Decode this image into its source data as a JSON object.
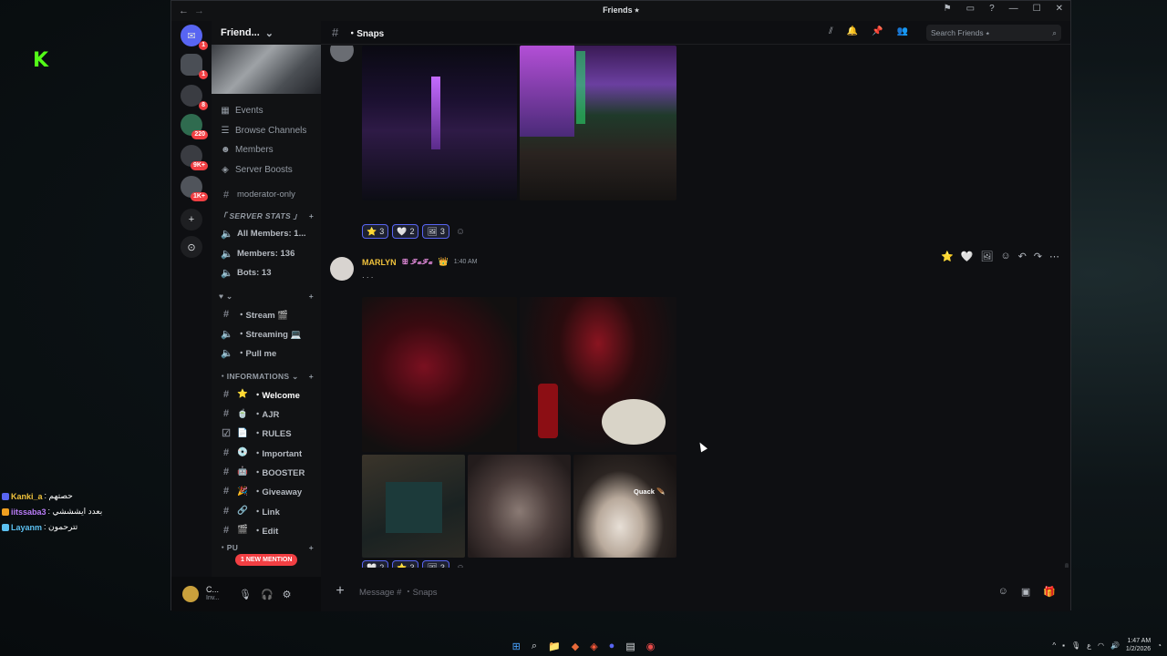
{
  "window": {
    "title": "Friends ⭑",
    "nav_back": "←",
    "nav_forward": "→"
  },
  "server": {
    "name": "Friend...",
    "rail_badges": [
      "1",
      "1",
      "8",
      "220",
      "9K+",
      "1K+"
    ]
  },
  "sidebar": {
    "nav_items": [
      {
        "label": "Events",
        "icon": "calendar-icon"
      },
      {
        "label": "Browse Channels",
        "icon": "browse-icon"
      },
      {
        "label": "Members",
        "icon": "members-icon"
      },
      {
        "label": "Server Boosts",
        "icon": "boost-icon"
      }
    ],
    "moderator_channel": "moderator-only",
    "stats_category": "「 SERVER STATS 」",
    "stats": [
      "All Members: 1...",
      "Members: 136",
      "Bots: 13"
    ],
    "voice_category": "♥ ⌄",
    "voice_channels": [
      "・Stream 🎬",
      "・Streaming 💻",
      "・Pull me"
    ],
    "info_category": "・INFORMATIONS ⌄",
    "info_channels": [
      {
        "label": "・Welcome",
        "emoji": "⭐",
        "active": true
      },
      {
        "label": "・AJR",
        "emoji": "🍵",
        "active": false
      },
      {
        "label": "・RULES",
        "emoji": "📄",
        "active": false
      },
      {
        "label": "・Important",
        "emoji": "💿",
        "active": false
      },
      {
        "label": "・BOOSTER",
        "emoji": "🤖",
        "active": false
      },
      {
        "label": "・Giveaway",
        "emoji": "🎉",
        "active": false
      },
      {
        "label": "・Link",
        "emoji": "🔗",
        "active": false
      },
      {
        "label": "・Edit",
        "emoji": "🎬",
        "active": false
      }
    ],
    "partial_category": "・PU",
    "mention_pill": "1 NEW MENTION"
  },
  "user_panel": {
    "name": "C...",
    "status": "Inv..."
  },
  "channel": {
    "name": "・Snaps",
    "search_placeholder": "Search Friends ⭑"
  },
  "messages": [
    {
      "author": "",
      "text": "",
      "reactions": [
        {
          "emoji": "⭐",
          "count": "3"
        },
        {
          "emoji": "🤍",
          "count": "2"
        },
        {
          "emoji": "🖼",
          "count": "3"
        }
      ]
    },
    {
      "author": "MARLYN",
      "badge": "👑",
      "role_tag": "ꕥ ℱ𝒶ℱ𝒶",
      "time": "1:40 AM",
      "text": "·  ·  ·",
      "image_caption": "Quack 🪶",
      "reactions": [
        {
          "emoji": "🤍",
          "count": "2"
        },
        {
          "emoji": "⭐",
          "count": "3"
        },
        {
          "emoji": "🖼",
          "count": "3"
        }
      ]
    }
  ],
  "composer": {
    "placeholder": "Message # ・Snaps"
  },
  "overlay_chat": [
    {
      "user": "Kanki_a",
      "message": ": حصتهم",
      "color": "#f0c23c"
    },
    {
      "user": "iitssaba3",
      "message": ": بعدد ايشششي",
      "color": "#b97cf7"
    },
    {
      "user": "Layanm",
      "message": ": تترحمون",
      "color": "#5bc0f0"
    }
  ],
  "taskbar": {
    "time": "1:47 AM",
    "date": "1/2/2026",
    "lang": "ع"
  },
  "colors": {
    "accent": "#5865f2",
    "mention": "#f23f43",
    "author": "#f0c23c"
  }
}
